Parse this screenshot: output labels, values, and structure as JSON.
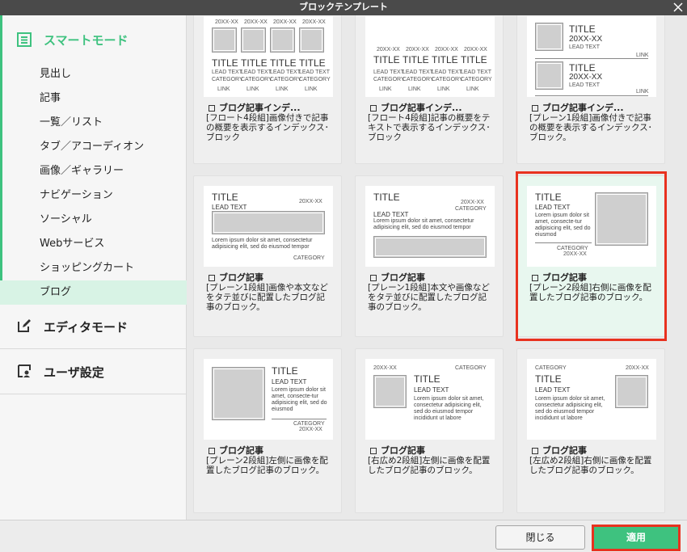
{
  "window": {
    "title": "ブロックテンプレート"
  },
  "sidebar": {
    "modes": {
      "smart": "スマートモード",
      "editor": "エディタモード",
      "user": "ユーザ設定"
    },
    "categories": [
      "見出し",
      "記事",
      "一覧／リスト",
      "タブ／アコーディオン",
      "画像／ギャラリー",
      "ナビゲーション",
      "ソーシャル",
      "Webサービス",
      "ショッピングカート",
      "ブログ"
    ],
    "active_category": "ブログ"
  },
  "cards": [
    {
      "title": "ブログ記事インデ...",
      "desc": "[フロート4段組]画像付きで記事の概要を表示するインデックス･ブロック"
    },
    {
      "title": "ブログ記事インデ...",
      "desc": "[フロート4段組]記事の概要をテキストで表示するインデックス･ブロック"
    },
    {
      "title": "ブログ記事インデ...",
      "desc": "[プレーン1段組]画像付きで記事の概要を表示するインデックス･ブロック。"
    },
    {
      "title": "ブログ記事",
      "desc": "[プレーン1段組]画像や本文などをタテ並びに配置したブログ記事のブロック。"
    },
    {
      "title": "ブログ記事",
      "desc": "[プレーン1段組]本文や画像などをタテ並びに配置したブログ記事のブロック。"
    },
    {
      "title": "ブログ記事",
      "desc": "[プレーン2段組]右側に画像を配置したブログ記事のブロック。"
    },
    {
      "title": "ブログ記事",
      "desc": "[プレーン2段組]左側に画像を配置したブログ記事のブロック。"
    },
    {
      "title": "ブログ記事",
      "desc": "[右広め2段組]左側に画像を配置したブログ記事のブロック。"
    },
    {
      "title": "ブログ記事",
      "desc": "[左広め2段組]右側に画像を配置したブログ記事のブロック。"
    }
  ],
  "selected_card_index": 5,
  "thumb": {
    "title": "TITLE",
    "lead": "LEAD TEXT",
    "category": "CATEGORY",
    "link": "LINK",
    "date": "20XX-XX",
    "body_short": "Lorem ipsum dolor sit amet, consectetur adipisicing elit, sed do eiusmod tempor",
    "body_narrow": "Lorem ipsum dolor sit amet, consecte-tur adipisicing elit, sed do eiusmod",
    "body_long": "Lorem ipsum dolor sit amet, consectetur adipisicing elit, sed do eiusmod tempor incididunt ut labore"
  },
  "footer": {
    "close_label": "閉じる",
    "apply_label": "適用"
  },
  "colors": {
    "accent": "#3ec27f",
    "highlight": "#e8321f",
    "titlebar": "#4a4a4a"
  }
}
